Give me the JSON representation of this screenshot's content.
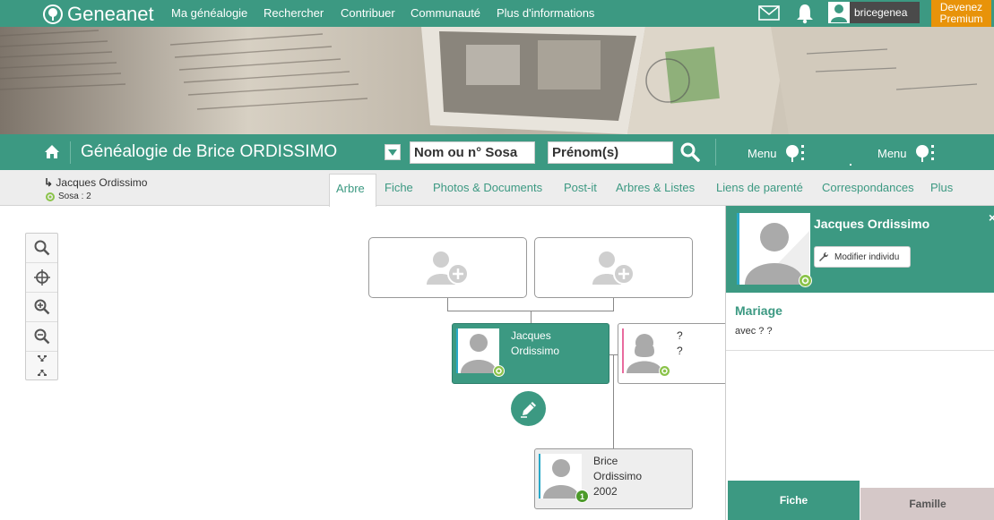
{
  "topbar": {
    "logo_text": "Geneanet",
    "nav": [
      "Ma généalogie",
      "Rechercher",
      "Contribuer",
      "Communauté",
      "Plus d'informations"
    ],
    "icons": [
      "mail-icon",
      "bell-icon",
      "user-icon"
    ],
    "username": "bricegenea",
    "premium": [
      "Devenez",
      "Premium"
    ]
  },
  "header": {
    "title": "Généalogie de Brice ORDISSIMO",
    "search_name_placeholder": "Nom ou n° Sosa",
    "search_firstname_placeholder": "Prénom(s)",
    "menu1": "Menu",
    "menu2": "Menu"
  },
  "breadcrumb": {
    "person": "Jacques Ordissimo",
    "sosa": "Sosa : 2"
  },
  "tabs": [
    "Arbre",
    "Fiche",
    "Photos & Documents",
    "Post-it",
    "Arbres & Listes",
    "Liens de parenté",
    "Correspondances",
    "Plus"
  ],
  "tree": {
    "focus": {
      "first": "Jacques",
      "last": "Ordissimo"
    },
    "spouse": {
      "first": "?",
      "last": "?"
    },
    "child": {
      "first": "Brice",
      "last": "Ordissimo",
      "year": "2002",
      "badge": "1"
    }
  },
  "panel": {
    "name": "Jacques Ordissimo",
    "edit_button": "Modifier individu",
    "section_title": "Mariage",
    "section_text": "avec ? ?",
    "close": "×",
    "tab_fiche": "Fiche",
    "tab_famille": "Famille"
  },
  "colors": {
    "brand": "#3c9982",
    "premium": "#e8930a",
    "famille_tab": "#d5c8c8"
  }
}
